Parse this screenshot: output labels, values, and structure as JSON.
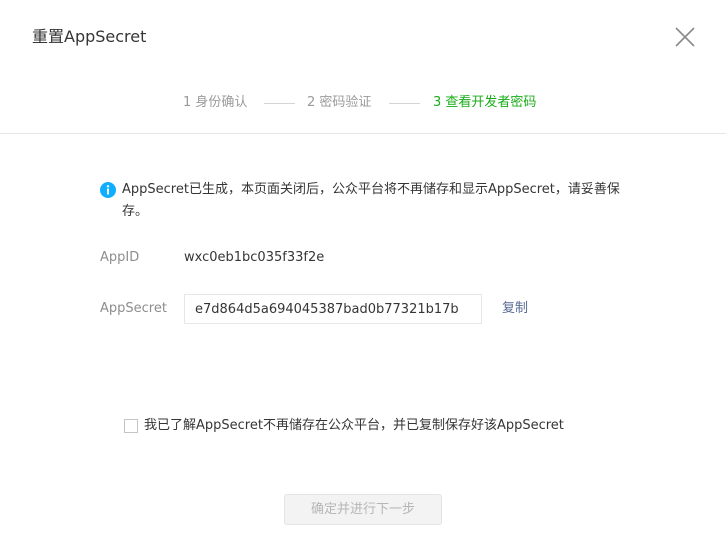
{
  "dialog": {
    "title": "重置AppSecret",
    "close_icon": "close-icon"
  },
  "steps": [
    {
      "label": "1 身份确认",
      "state": "done"
    },
    {
      "label": "2 密码验证",
      "state": "done"
    },
    {
      "label": "3 查看开发者密码",
      "state": "active"
    }
  ],
  "colors": {
    "active_step": "#1aad19",
    "info_icon": "#10aeff",
    "link": "#576b95",
    "muted": "#9a9a9a"
  },
  "notice": {
    "icon": "info-icon",
    "text": "AppSecret已生成，本页面关闭后，公众平台将不再储存和显示AppSecret，请妥善保存。"
  },
  "fields": {
    "appid": {
      "label": "AppID",
      "value": "wxc0eb1bc035f33f2e"
    },
    "appsecret": {
      "label": "AppSecret",
      "value": "e7d864d5a694045387bad0b77321b17b"
    },
    "copy_label": "复制"
  },
  "agreement": {
    "checked": false,
    "text": "我已了解AppSecret不再储存在公众平台，并已复制保存好该AppSecret"
  },
  "actions": {
    "confirm_label": "确定并进行下一步",
    "confirm_enabled": false
  }
}
